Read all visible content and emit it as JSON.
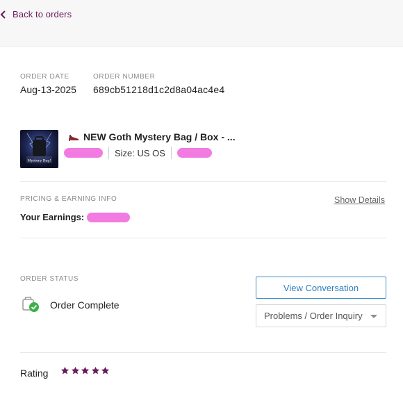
{
  "nav": {
    "back_label": "Back to orders"
  },
  "order": {
    "date_label": "ORDER DATE",
    "date_value": "Aug-13-2025",
    "number_label": "ORDER NUMBER",
    "number_value": "689cb51218d1c2d8a04ac4e4"
  },
  "item": {
    "thumbnail_text": "Mystery Bag!",
    "title": "NEW Goth Mystery Bag / Box - ...",
    "size": "Size: US OS"
  },
  "pricing": {
    "label": "PRICING & EARNING INFO",
    "show_details": "Show Details",
    "earnings_label": "Your Earnings:"
  },
  "status": {
    "label": "ORDER STATUS",
    "value": "Order Complete",
    "view_conversation": "View Conversation",
    "problems_label": "Problems / Order Inquiry"
  },
  "rating": {
    "label": "Rating",
    "stars": 5,
    "max": 5
  },
  "colors": {
    "accent": "#6b1a5a",
    "star": "#6b1a5a",
    "link_blue": "#2f7fbf",
    "redaction": "#f27be1",
    "success": "#3cb04a"
  }
}
